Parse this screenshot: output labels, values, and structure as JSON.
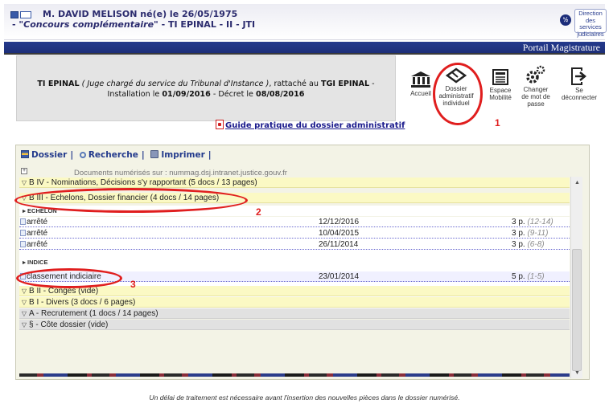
{
  "header": {
    "user_line": "M. DAVID MELISON né(e) le 26/05/1975",
    "concours_prefix": "- ",
    "concours": "\"Concours complémentaire\"",
    "concours_suffix": " - TI EPINAL - II - JTI",
    "badge": "½",
    "dsj_logo": "Direction des services judiciaires",
    "portal_title": "Portail Magistrature"
  },
  "info": {
    "court": "TI EPINAL",
    "role": "( Juge chargé du service du Tribunal d'Instance )",
    "attached": ", rattaché au",
    "attached_court": "TGI EPINAL",
    "dash": "-",
    "install_label": "Installation le",
    "install_date": "01/09/2016",
    "decree_label": "- Décret le",
    "decree_date": "08/08/2016"
  },
  "toolbar": {
    "accueil": "Accueil",
    "dossier_line1": "Dossier",
    "dossier_line2": "administratif",
    "dossier_line3": "individuel",
    "mobilite_line1": "Espace",
    "mobilite_line2": "Mobilité",
    "mdp_line1": "Changer",
    "mdp_line2": "de mot de",
    "mdp_line3": "passe",
    "deco_line1": "Se",
    "deco_line2": "déconnecter"
  },
  "annotations": [
    "1",
    "2",
    "3"
  ],
  "guide_link": "Guide pratique du dossier administratif",
  "dossier_menu": {
    "dossier": "Dossier",
    "recherche": "Recherche",
    "imprimer": "Imprimer",
    "separator": "|"
  },
  "docs_source": "Documents numérisés sur : nummag.dsj.intranet.justice.gouv.fr",
  "tree": {
    "b4": "B IV - Nominations, Décisions s'y rapportant (5 docs / 13 pages)",
    "b3": "B III - Echelons, Dossier financier (4 docs / 14 pages)",
    "echelon_label": "ECHELON",
    "echelon_docs": [
      {
        "name": "arrêté",
        "date": "12/12/2016",
        "pages": "3 p.",
        "range": "(12-14)"
      },
      {
        "name": "arrêté",
        "date": "10/04/2015",
        "pages": "3 p.",
        "range": "(9-11)"
      },
      {
        "name": "arrêté",
        "date": "26/11/2014",
        "pages": "3 p.",
        "range": "(6-8)"
      }
    ],
    "indice_label": "INDICE",
    "indice_docs": [
      {
        "name": "classement indiciaire",
        "date": "23/01/2014",
        "pages": "5 p.",
        "range": "(1-5)"
      }
    ],
    "b2": "B II - Congés (vide)",
    "b1": "B I - Divers (3 docs / 6 pages)",
    "a": "A - Recrutement (1 docs / 14 pages)",
    "cote": "§ - Côte dossier (vide)"
  },
  "footer_note": "Un délai de traitement est nécessaire avant l'insertion des nouvelles pièces dans le dossier numérisé.",
  "colors": {
    "portal_bar": "#1d2f78",
    "annotation_red": "#e01e1e",
    "section_yellow": "#fbf9c4",
    "link_blue": "#1a1a8c"
  }
}
